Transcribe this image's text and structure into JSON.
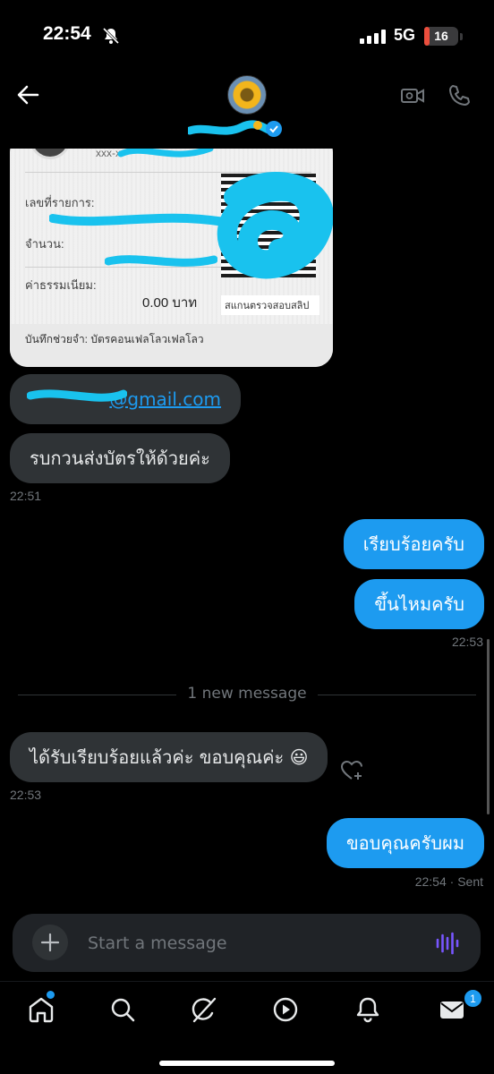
{
  "status_bar": {
    "time": "22:54",
    "network": "5G",
    "battery_level": "16",
    "battery_fraction": 0.16
  },
  "header": {
    "back_icon": "arrow-left-icon",
    "video_icon": "video-camera-icon",
    "call_icon": "phone-icon",
    "verified_icon": "verified-badge-icon"
  },
  "slip": {
    "masked_account": "xxx-x",
    "transaction_label": "เลขที่รายการ:",
    "amount_label": "จำนวน:",
    "fee_label": "ค่าธรรมเนียม:",
    "fee_value": "0.00 บาท",
    "qr_caption": "สแกนตรวจสอบสลิป",
    "memo": "บันทึกช่วยจำ: บัตรคอนเฟลโลวเฟลโลว"
  },
  "messages": [
    {
      "direction": "in",
      "text": "@gmail.com"
    },
    {
      "direction": "in",
      "text": "รบกวนส่งบัตรให้ด้วยค่ะ",
      "time": "22:51"
    },
    {
      "direction": "out",
      "text": "เรียบร้อยครับ"
    },
    {
      "direction": "out",
      "text": "ขึ้นไหมครับ",
      "time": "22:53"
    },
    {
      "direction": "in",
      "text": "ได้รับเรียบร้อยแล้วค่ะ ขอบคุณค่ะ 😃",
      "time": "22:53"
    },
    {
      "direction": "out",
      "text": "ขอบคุณครับผม",
      "time": "22:54 · Sent"
    }
  ],
  "new_message_divider": "1 new message",
  "composer": {
    "placeholder": "Start a message"
  },
  "tab_bar": {
    "tabs": [
      "home-icon",
      "search-icon",
      "grok-icon",
      "video-play-icon",
      "notifications-bell-icon",
      "messages-envelope-icon"
    ],
    "messages_badge": "1"
  },
  "colors": {
    "accent": "#1d9bf0",
    "incoming_bubble": "#2f3336",
    "background": "#000000",
    "redaction": "#19c2ee"
  }
}
